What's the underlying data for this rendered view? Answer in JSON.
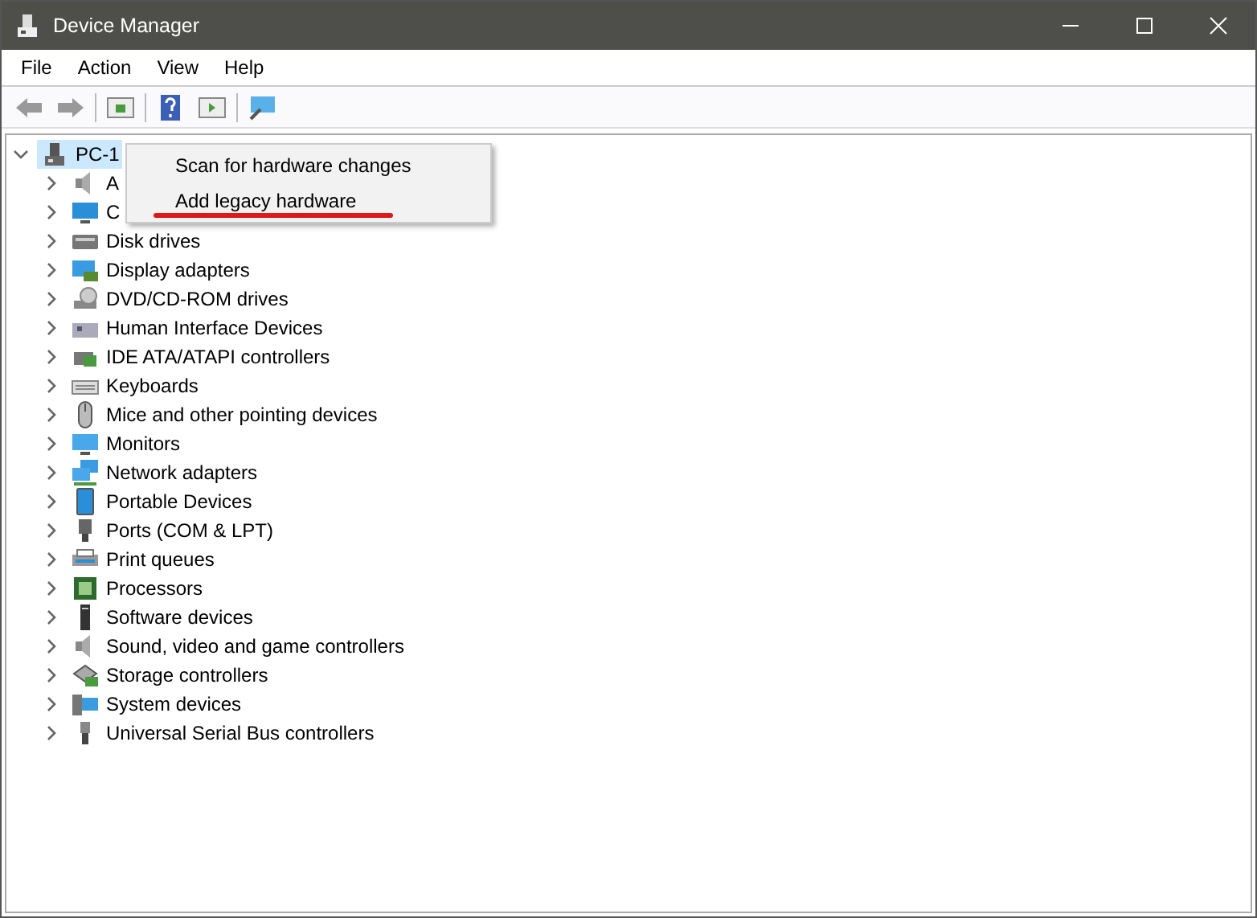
{
  "window": {
    "title": "Device Manager"
  },
  "menu_bar": [
    "File",
    "Action",
    "View",
    "Help"
  ],
  "tree": {
    "label": "PC-1",
    "expanded": true,
    "selected": true,
    "children": [
      {
        "label": "A",
        "expanded": false
      },
      {
        "label": "C",
        "expanded": false
      },
      {
        "label": "Disk drives",
        "expanded": false
      },
      {
        "label": "Display adapters",
        "expanded": false
      },
      {
        "label": "DVD/CD-ROM drives",
        "expanded": false
      },
      {
        "label": "Human Interface Devices",
        "expanded": false
      },
      {
        "label": "IDE ATA/ATAPI controllers",
        "expanded": false
      },
      {
        "label": "Keyboards",
        "expanded": false
      },
      {
        "label": "Mice and other pointing devices",
        "expanded": false
      },
      {
        "label": "Monitors",
        "expanded": false
      },
      {
        "label": "Network adapters",
        "expanded": false
      },
      {
        "label": "Portable Devices",
        "expanded": false
      },
      {
        "label": "Ports (COM & LPT)",
        "expanded": false
      },
      {
        "label": "Print queues",
        "expanded": false
      },
      {
        "label": "Processors",
        "expanded": false
      },
      {
        "label": "Software devices",
        "expanded": false
      },
      {
        "label": "Sound, video and game controllers",
        "expanded": false
      },
      {
        "label": "Storage controllers",
        "expanded": false
      },
      {
        "label": "System devices",
        "expanded": false
      },
      {
        "label": "Universal Serial Bus controllers",
        "expanded": false
      }
    ]
  },
  "context_menu": {
    "items": [
      {
        "label": "Scan for hardware changes",
        "underlined": false
      },
      {
        "label": "Add legacy hardware",
        "underlined": true
      }
    ]
  }
}
